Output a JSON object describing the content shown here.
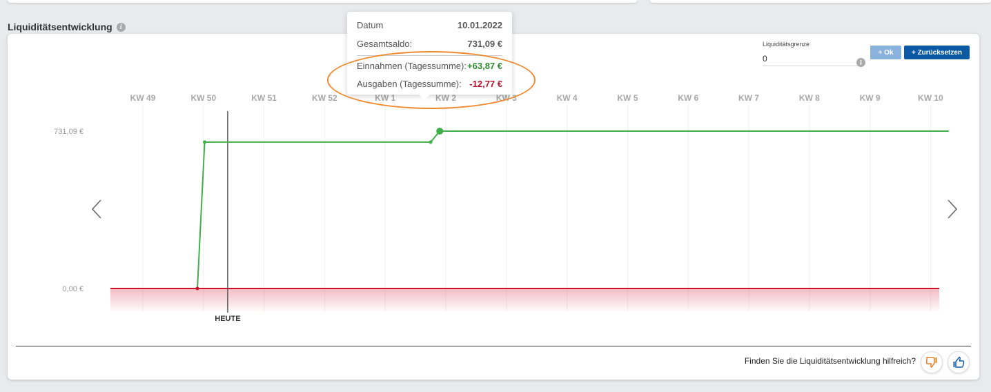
{
  "section": {
    "title": "Liquiditätsentwicklung"
  },
  "limit": {
    "label": "Liquiditätsgrenze",
    "value": "0"
  },
  "buttons": {
    "ok_label": "+ Ok",
    "reset_label": "+ Zurücksetzen"
  },
  "tooltip": {
    "rows": [
      {
        "label": "Datum",
        "value": "10.01.2022"
      },
      {
        "label": "Gesamtsaldo:",
        "value": "731,09 €"
      },
      {
        "label": "Einnahmen (Tagessumme):",
        "value": "+63,87 €"
      },
      {
        "label": "Ausgaben (Tagessumme):",
        "value": "-12,77 €"
      }
    ]
  },
  "feedback": {
    "question": "Finden Sie die Liquiditätsentwicklung hilfreich?"
  },
  "colors": {
    "accent": "#0c5aa6",
    "balance_line": "#3fae49",
    "limit_line": "#d0112b",
    "highlight": "#f08a2e",
    "income": "#2f8a2f",
    "expense": "#b3102e"
  },
  "chart_data": {
    "type": "line",
    "categories": [
      "KW 49",
      "KW 50",
      "KW 51",
      "KW 52",
      "KW 1",
      "KW 2",
      "KW 3",
      "KW 4",
      "KW 5",
      "KW 6",
      "KW 7",
      "KW 8",
      "KW 9",
      "KW 10"
    ],
    "today_label": "HEUTE",
    "today_week": 1.4,
    "y_ticks": [
      {
        "label": "731,09 €",
        "value": 731.09
      },
      {
        "label": "0,00 €",
        "value": 0
      }
    ],
    "ylim": [
      0,
      731.09
    ],
    "series": [
      {
        "points": [
          {
            "week": 0.9,
            "value": 0
          },
          {
            "week": 1.02,
            "value": 679.99
          },
          {
            "week": 4.75,
            "value": 679.99
          },
          {
            "week": 4.9,
            "value": 731.09
          },
          {
            "week": 13.3,
            "value": 731.09
          }
        ],
        "highlight_index": 3
      }
    ],
    "limit_value": 0
  }
}
